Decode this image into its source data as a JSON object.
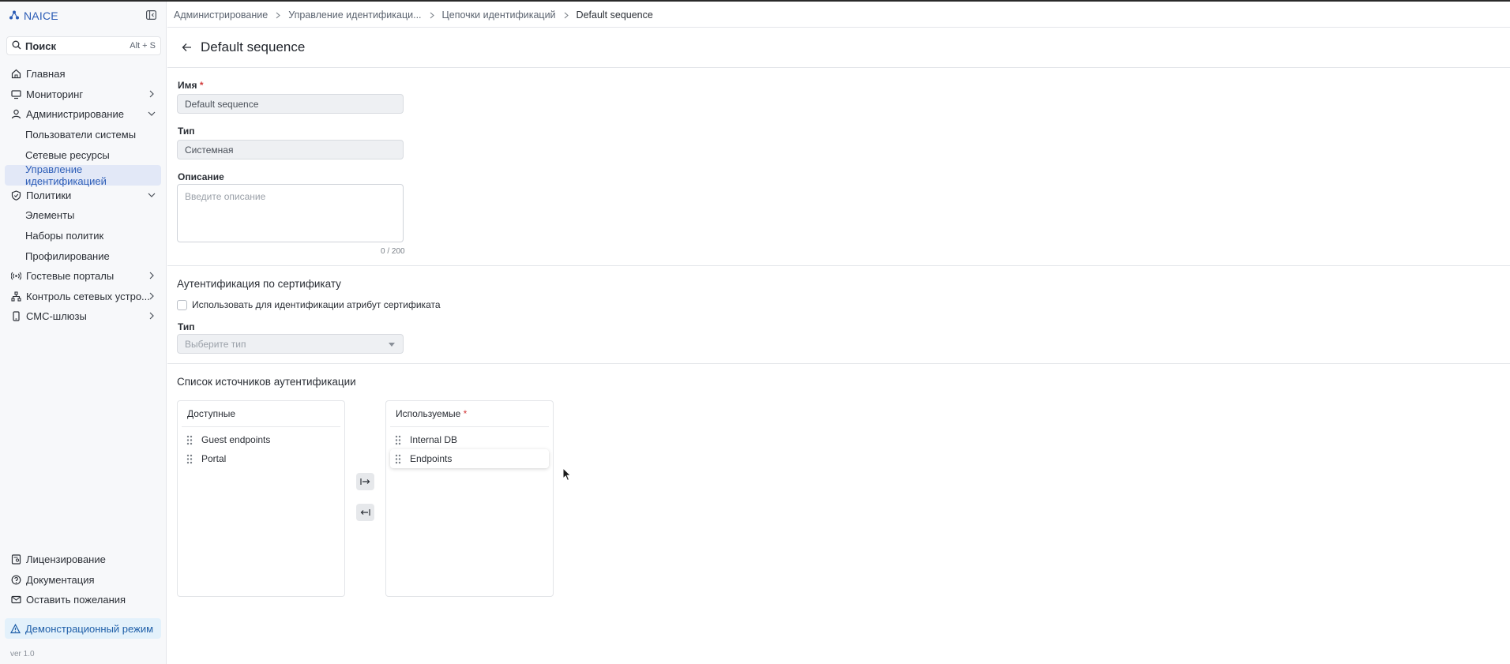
{
  "app": {
    "brand": "NAICE",
    "version": "ver 1.0"
  },
  "search": {
    "label": "Поиск",
    "shortcut": "Alt + S"
  },
  "sidebar": {
    "items": [
      {
        "label": "Главная",
        "icon": "home-icon"
      },
      {
        "label": "Мониторинг",
        "icon": "monitor-icon",
        "expandable": true,
        "expanded": false
      },
      {
        "label": "Администрирование",
        "icon": "user-icon",
        "expandable": true,
        "expanded": true
      },
      {
        "label": "Пользователи системы",
        "sub": true
      },
      {
        "label": "Сетевые ресурсы",
        "sub": true
      },
      {
        "label": "Управление идентификацией",
        "sub": true,
        "active": true
      },
      {
        "label": "Политики",
        "icon": "shield-icon",
        "expandable": true,
        "expanded": true
      },
      {
        "label": "Элементы",
        "sub": true
      },
      {
        "label": "Наборы политик",
        "sub": true
      },
      {
        "label": "Профилирование",
        "sub": true
      },
      {
        "label": "Гостевые порталы",
        "icon": "broadcast-icon",
        "expandable": true,
        "expanded": false
      },
      {
        "label": "Контроль сетевых устро...",
        "icon": "network-icon",
        "expandable": true,
        "expanded": false
      },
      {
        "label": "СМС-шлюзы",
        "icon": "phone-icon",
        "expandable": true,
        "expanded": false
      }
    ],
    "bottom": [
      {
        "label": "Лицензирование",
        "icon": "license-icon"
      },
      {
        "label": "Документация",
        "icon": "help-icon"
      },
      {
        "label": "Оставить пожелания",
        "icon": "mail-icon"
      }
    ],
    "demo": "Демонстрационный режим"
  },
  "breadcrumb": [
    "Администрирование",
    "Управление идентификаци...",
    "Цепочки идентификаций",
    "Default sequence"
  ],
  "page": {
    "title": "Default sequence"
  },
  "form": {
    "name_label": "Имя",
    "name_value": "Default sequence",
    "type_label": "Тип",
    "type_value": "Системная",
    "description_label": "Описание",
    "description_placeholder": "Введите описание",
    "description_counter": "0 / 200"
  },
  "cert": {
    "title": "Аутентификация по сертификату",
    "checkbox_label": "Использовать для идентификации атрибут сертификата",
    "checked": false,
    "type_label": "Тип",
    "type_placeholder": "Выберите тип"
  },
  "sources": {
    "title": "Список источников аутентификации",
    "available_label": "Доступные",
    "available": [
      "Guest endpoints",
      "Portal"
    ],
    "used_label": "Используемые",
    "used": [
      "Internal DB",
      "Endpoints"
    ]
  },
  "colors": {
    "accent": "#2f5fb8",
    "active_bg": "#e2e8f7",
    "demo_bg": "#e3f1fb",
    "required": "#d23a3a"
  }
}
